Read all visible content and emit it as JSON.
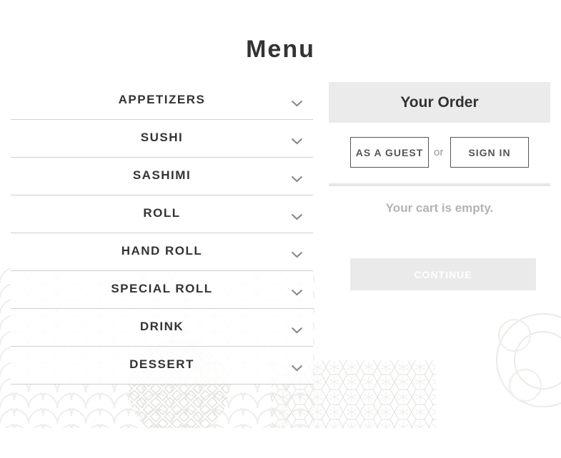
{
  "page": {
    "title": "Menu"
  },
  "menu": {
    "categories": [
      {
        "label": "APPETIZERS"
      },
      {
        "label": "SUSHI"
      },
      {
        "label": "SASHIMI"
      },
      {
        "label": "ROLL"
      },
      {
        "label": "HAND ROLL"
      },
      {
        "label": "SPECIAL ROLL"
      },
      {
        "label": "DRINK"
      },
      {
        "label": "DESSERT"
      }
    ],
    "expand_icon": "chevron-down-icon"
  },
  "order": {
    "title": "Your Order",
    "guest_label": "AS A GUEST",
    "or_label": "or",
    "signin_label": "SIGN IN",
    "empty_message": "Your cart is empty.",
    "continue_label": "CONTINUE"
  },
  "colors": {
    "text": "#333333",
    "panel_header_bg": "#ebebeb",
    "muted": "#b3b3b3",
    "disabled_button_bg": "#eaeaea"
  }
}
